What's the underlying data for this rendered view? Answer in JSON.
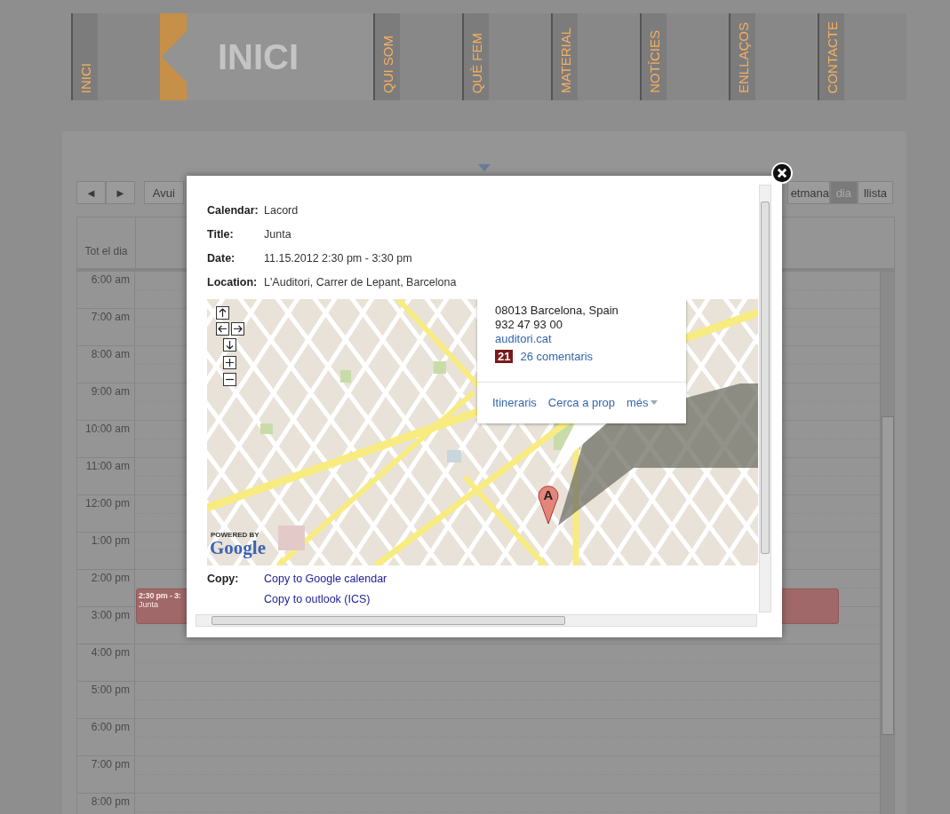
{
  "nav": {
    "items": [
      {
        "label": "INICI"
      },
      {
        "label": "QUI SOM"
      },
      {
        "label": "QUÈ FEM"
      },
      {
        "label": "MATERIAL"
      },
      {
        "label": "NOTÍCIES"
      },
      {
        "label": "ENLLAÇOS"
      },
      {
        "label": "CONTACTE"
      }
    ],
    "logo_text": "INICI"
  },
  "calendar": {
    "nav_buttons": [
      "◄",
      "►"
    ],
    "today": "Avui",
    "views": [
      {
        "label": "etmana",
        "selected": false
      },
      {
        "label": "dia",
        "selected": true
      },
      {
        "label": "llista",
        "selected": false
      }
    ],
    "all_day_label": "Tot el dia",
    "hours": [
      {
        "label": "6:00 am"
      },
      {
        "label": "7:00 am"
      },
      {
        "label": "8:00 am"
      },
      {
        "label": "9:00 am"
      },
      {
        "label": "10:00 am"
      },
      {
        "label": "11:00 am"
      },
      {
        "label": "12:00 pm"
      },
      {
        "label": "1:00 pm"
      },
      {
        "label": "2:00 pm",
        "events": [
          {
            "time": "2:30 pm - 3:",
            "title": "Junta"
          }
        ]
      },
      {
        "label": "3:00 pm"
      },
      {
        "label": "4:00 pm"
      },
      {
        "label": "5:00 pm"
      },
      {
        "label": "6:00 pm"
      },
      {
        "label": "7:00 pm"
      },
      {
        "label": "8:00 pm"
      }
    ]
  },
  "popup": {
    "fields": [
      {
        "label": "Calendar:",
        "value": "Lacord"
      },
      {
        "label": "Title:",
        "value": "Junta"
      },
      {
        "label": "Date:",
        "value": "11.15.2012 2:30 pm - 3:30 pm"
      },
      {
        "label": "Location:",
        "value": "L'Auditori, Carrer de Lepant, Barcelona"
      }
    ],
    "map": {
      "info": {
        "lines": [
          "08013 Barcelona, Spain",
          "932 47 93 00"
        ],
        "website": "auditori.cat",
        "rating": "21",
        "reviews": "26 comentaris",
        "actions": [
          "Itineraris",
          "Cerca a prop",
          "més"
        ]
      },
      "marker_label": "A",
      "powered_by": "POWERED BY",
      "logo": "Google"
    },
    "copy": {
      "label": "Copy:",
      "links": [
        "Copy to Google calendar",
        "Copy to outlook (ICS)"
      ]
    }
  }
}
